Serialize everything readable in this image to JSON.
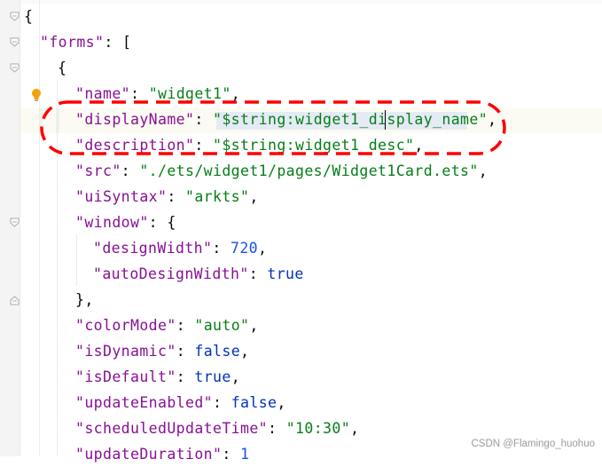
{
  "editor": {
    "lines": [
      [
        {
          "t": "{",
          "c": "p"
        }
      ],
      [
        {
          "t": "\"forms\"",
          "c": "k"
        },
        {
          "t": ": [",
          "c": "p"
        }
      ],
      [
        {
          "t": "{",
          "c": "p"
        }
      ],
      [
        {
          "t": "\"name\"",
          "c": "k"
        },
        {
          "t": ": ",
          "c": "p"
        },
        {
          "t": "\"widget1\"",
          "c": "s"
        },
        {
          "t": ",",
          "c": "p"
        }
      ],
      [
        {
          "t": "\"displayName\"",
          "c": "k"
        },
        {
          "t": ": ",
          "c": "p"
        },
        {
          "t": "\"$string:widget1_display_name\"",
          "c": "s"
        },
        {
          "t": ",",
          "c": "p"
        }
      ],
      [
        {
          "t": "\"description\"",
          "c": "k"
        },
        {
          "t": ": ",
          "c": "p"
        },
        {
          "t": "\"$string:widget1_desc\"",
          "c": "s"
        },
        {
          "t": ",",
          "c": "p"
        }
      ],
      [
        {
          "t": "\"src\"",
          "c": "k"
        },
        {
          "t": ": ",
          "c": "p"
        },
        {
          "t": "\"./ets/widget1/pages/Widget1Card.ets\"",
          "c": "s"
        },
        {
          "t": ",",
          "c": "p"
        }
      ],
      [
        {
          "t": "\"uiSyntax\"",
          "c": "k"
        },
        {
          "t": ": ",
          "c": "p"
        },
        {
          "t": "\"arkts\"",
          "c": "s"
        },
        {
          "t": ",",
          "c": "p"
        }
      ],
      [
        {
          "t": "\"window\"",
          "c": "k"
        },
        {
          "t": ": {",
          "c": "p"
        }
      ],
      [
        {
          "t": "\"designWidth\"",
          "c": "k"
        },
        {
          "t": ": ",
          "c": "p"
        },
        {
          "t": "720",
          "c": "n"
        },
        {
          "t": ",",
          "c": "p"
        }
      ],
      [
        {
          "t": "\"autoDesignWidth\"",
          "c": "k"
        },
        {
          "t": ": ",
          "c": "p"
        },
        {
          "t": "true",
          "c": "b"
        }
      ],
      [
        {
          "t": "},",
          "c": "p"
        }
      ],
      [
        {
          "t": "\"colorMode\"",
          "c": "k"
        },
        {
          "t": ": ",
          "c": "p"
        },
        {
          "t": "\"auto\"",
          "c": "s"
        },
        {
          "t": ",",
          "c": "p"
        }
      ],
      [
        {
          "t": "\"isDynamic\"",
          "c": "k"
        },
        {
          "t": ": ",
          "c": "p"
        },
        {
          "t": "false",
          "c": "b"
        },
        {
          "t": ",",
          "c": "p"
        }
      ],
      [
        {
          "t": "\"isDefault\"",
          "c": "k"
        },
        {
          "t": ": ",
          "c": "p"
        },
        {
          "t": "true",
          "c": "b"
        },
        {
          "t": ",",
          "c": "p"
        }
      ],
      [
        {
          "t": "\"updateEnabled\"",
          "c": "k"
        },
        {
          "t": ": ",
          "c": "p"
        },
        {
          "t": "false",
          "c": "b"
        },
        {
          "t": ",",
          "c": "p"
        }
      ],
      [
        {
          "t": "\"scheduledUpdateTime\"",
          "c": "k"
        },
        {
          "t": ": ",
          "c": "p"
        },
        {
          "t": "\"10:30\"",
          "c": "s"
        },
        {
          "t": ",",
          "c": "p"
        }
      ],
      [
        {
          "t": "\"updateDuration\"",
          "c": "k"
        },
        {
          "t": ": ",
          "c": "p"
        },
        {
          "t": "1",
          "c": "n"
        }
      ]
    ],
    "colors": {
      "key": "#871094",
      "string": "#067d17",
      "number": "#1750eb",
      "keyword": "#0033b3",
      "annotation": "#ff0000"
    },
    "icons": [
      "fold-icon",
      "intention-bulb-icon"
    ]
  },
  "watermark": "CSDN @Flamingo_huohuo"
}
